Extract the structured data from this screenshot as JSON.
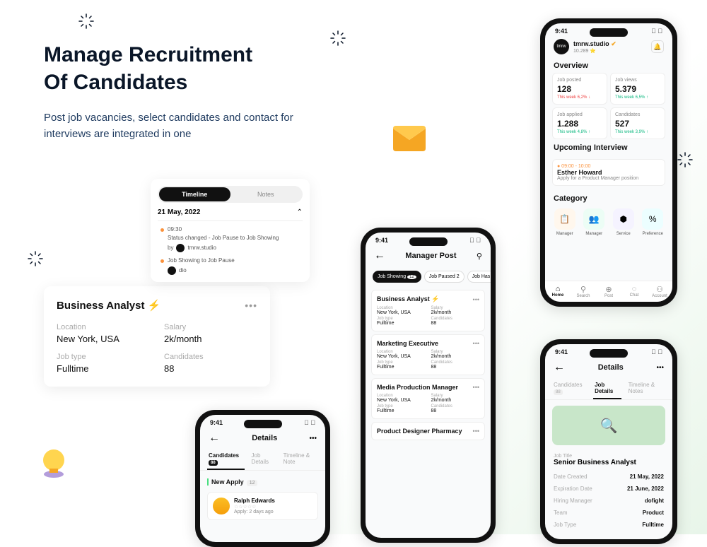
{
  "hero": {
    "title_line1": "Manage Recruitment",
    "title_line2": "Of Candidates",
    "subtitle": "Post job vacancies, select candidates and contact for interviews are integrated in one"
  },
  "timeline": {
    "tab1": "Timeline",
    "tab2": "Notes",
    "date": "21 May, 2022",
    "entry1_time": "09:30",
    "entry1_text": "Status changed - Job Pause to Job Showing",
    "entry1_by_label": "by",
    "entry1_by": "tmrw.studio",
    "entry2_text": "Job Showing to Job Pause",
    "entry2_by": "dio"
  },
  "ba_card": {
    "title": "Business Analyst ⚡",
    "location_label": "Location",
    "location": "New York, USA",
    "salary_label": "Salary",
    "salary": "2k/month",
    "jobtype_label": "Job type",
    "jobtype": "Fulltime",
    "candidates_label": "Candidates",
    "candidates": "88"
  },
  "phone1": {
    "time": "9:41",
    "brand": "tmrw.studio",
    "brand_sub": "10.289 ⭐",
    "overview_title": "Overview",
    "stats": {
      "posted_label": "Job posted",
      "posted_value": "128",
      "posted_delta": "This week  6,2% ↓",
      "views_label": "Job views",
      "views_value": "5.379",
      "views_delta": "This week  6,5% ↑",
      "applied_label": "Job applied",
      "applied_value": "1.288",
      "applied_delta": "This week  4,8% ↑",
      "cand_label": "Candidates",
      "cand_value": "527",
      "cand_delta": "This week  3,9% ↑"
    },
    "upcoming_title": "Upcoming Interview",
    "iv_time": "● 09:00 - 10:00",
    "iv_name": "Esther Howard",
    "iv_pos": "Apply for a Product Manager position",
    "category_title": "Category",
    "cats": {
      "c1": "Manager",
      "c2": "Manager",
      "c3": "Service",
      "c4": "Preference"
    },
    "nav": {
      "home": "Home",
      "search": "Search",
      "post": "Post",
      "chat": "Chat",
      "account": "Account"
    }
  },
  "phone2": {
    "time": "9:41",
    "title": "Details",
    "tab1": "Candidates",
    "tab1_count": "88",
    "tab2": "Job Details",
    "tab3": "Timeline & Notes",
    "jt_label": "Job Title",
    "jt_value": "Senior Business Analyst",
    "created_label": "Date Created",
    "created_value": "21 May, 2022",
    "exp_label": "Expiration Date",
    "exp_value": "21 June, 2022",
    "mgr_label": "Hiring Manager",
    "mgr_value": "dofight",
    "team_label": "Team",
    "team_value": "Product",
    "type_label": "Job Type",
    "type_value": "Fulltime"
  },
  "phone3": {
    "time": "9:41",
    "title": "Manager Post",
    "chip1": "Job Showing",
    "chip1_count": "12",
    "chip2": "Job Paused",
    "chip2_count": "2",
    "chip3": "Job Has Ex",
    "jobs": [
      {
        "name": "Business Analyst ⚡",
        "loc": "New York, USA",
        "sal": "2k/month",
        "type": "Fulltime",
        "cand": "88"
      },
      {
        "name": "Marketing Executive",
        "loc": "New York, USA",
        "sal": "2k/month",
        "type": "Fulltime",
        "cand": "88"
      },
      {
        "name": "Media Production Manager",
        "loc": "New York, USA",
        "sal": "2k/month",
        "type": "Fulltime",
        "cand": "88"
      },
      {
        "name": "Product Designer Pharmacy",
        "loc": "",
        "sal": "",
        "type": "",
        "cand": ""
      }
    ],
    "loc_label": "Location",
    "sal_label": "Salary",
    "type_label": "Job type",
    "cand_label": "Candidates"
  },
  "phone4": {
    "time": "9:41",
    "title": "Details",
    "tab1": "Candidates",
    "tab1_count": "88",
    "tab2": "Job Details",
    "tab3": "Timeline & Note",
    "section": "New Apply",
    "section_count": "12",
    "cand_name": "Ralph Edwards",
    "apply_ago": "Apply: 2 days ago"
  }
}
